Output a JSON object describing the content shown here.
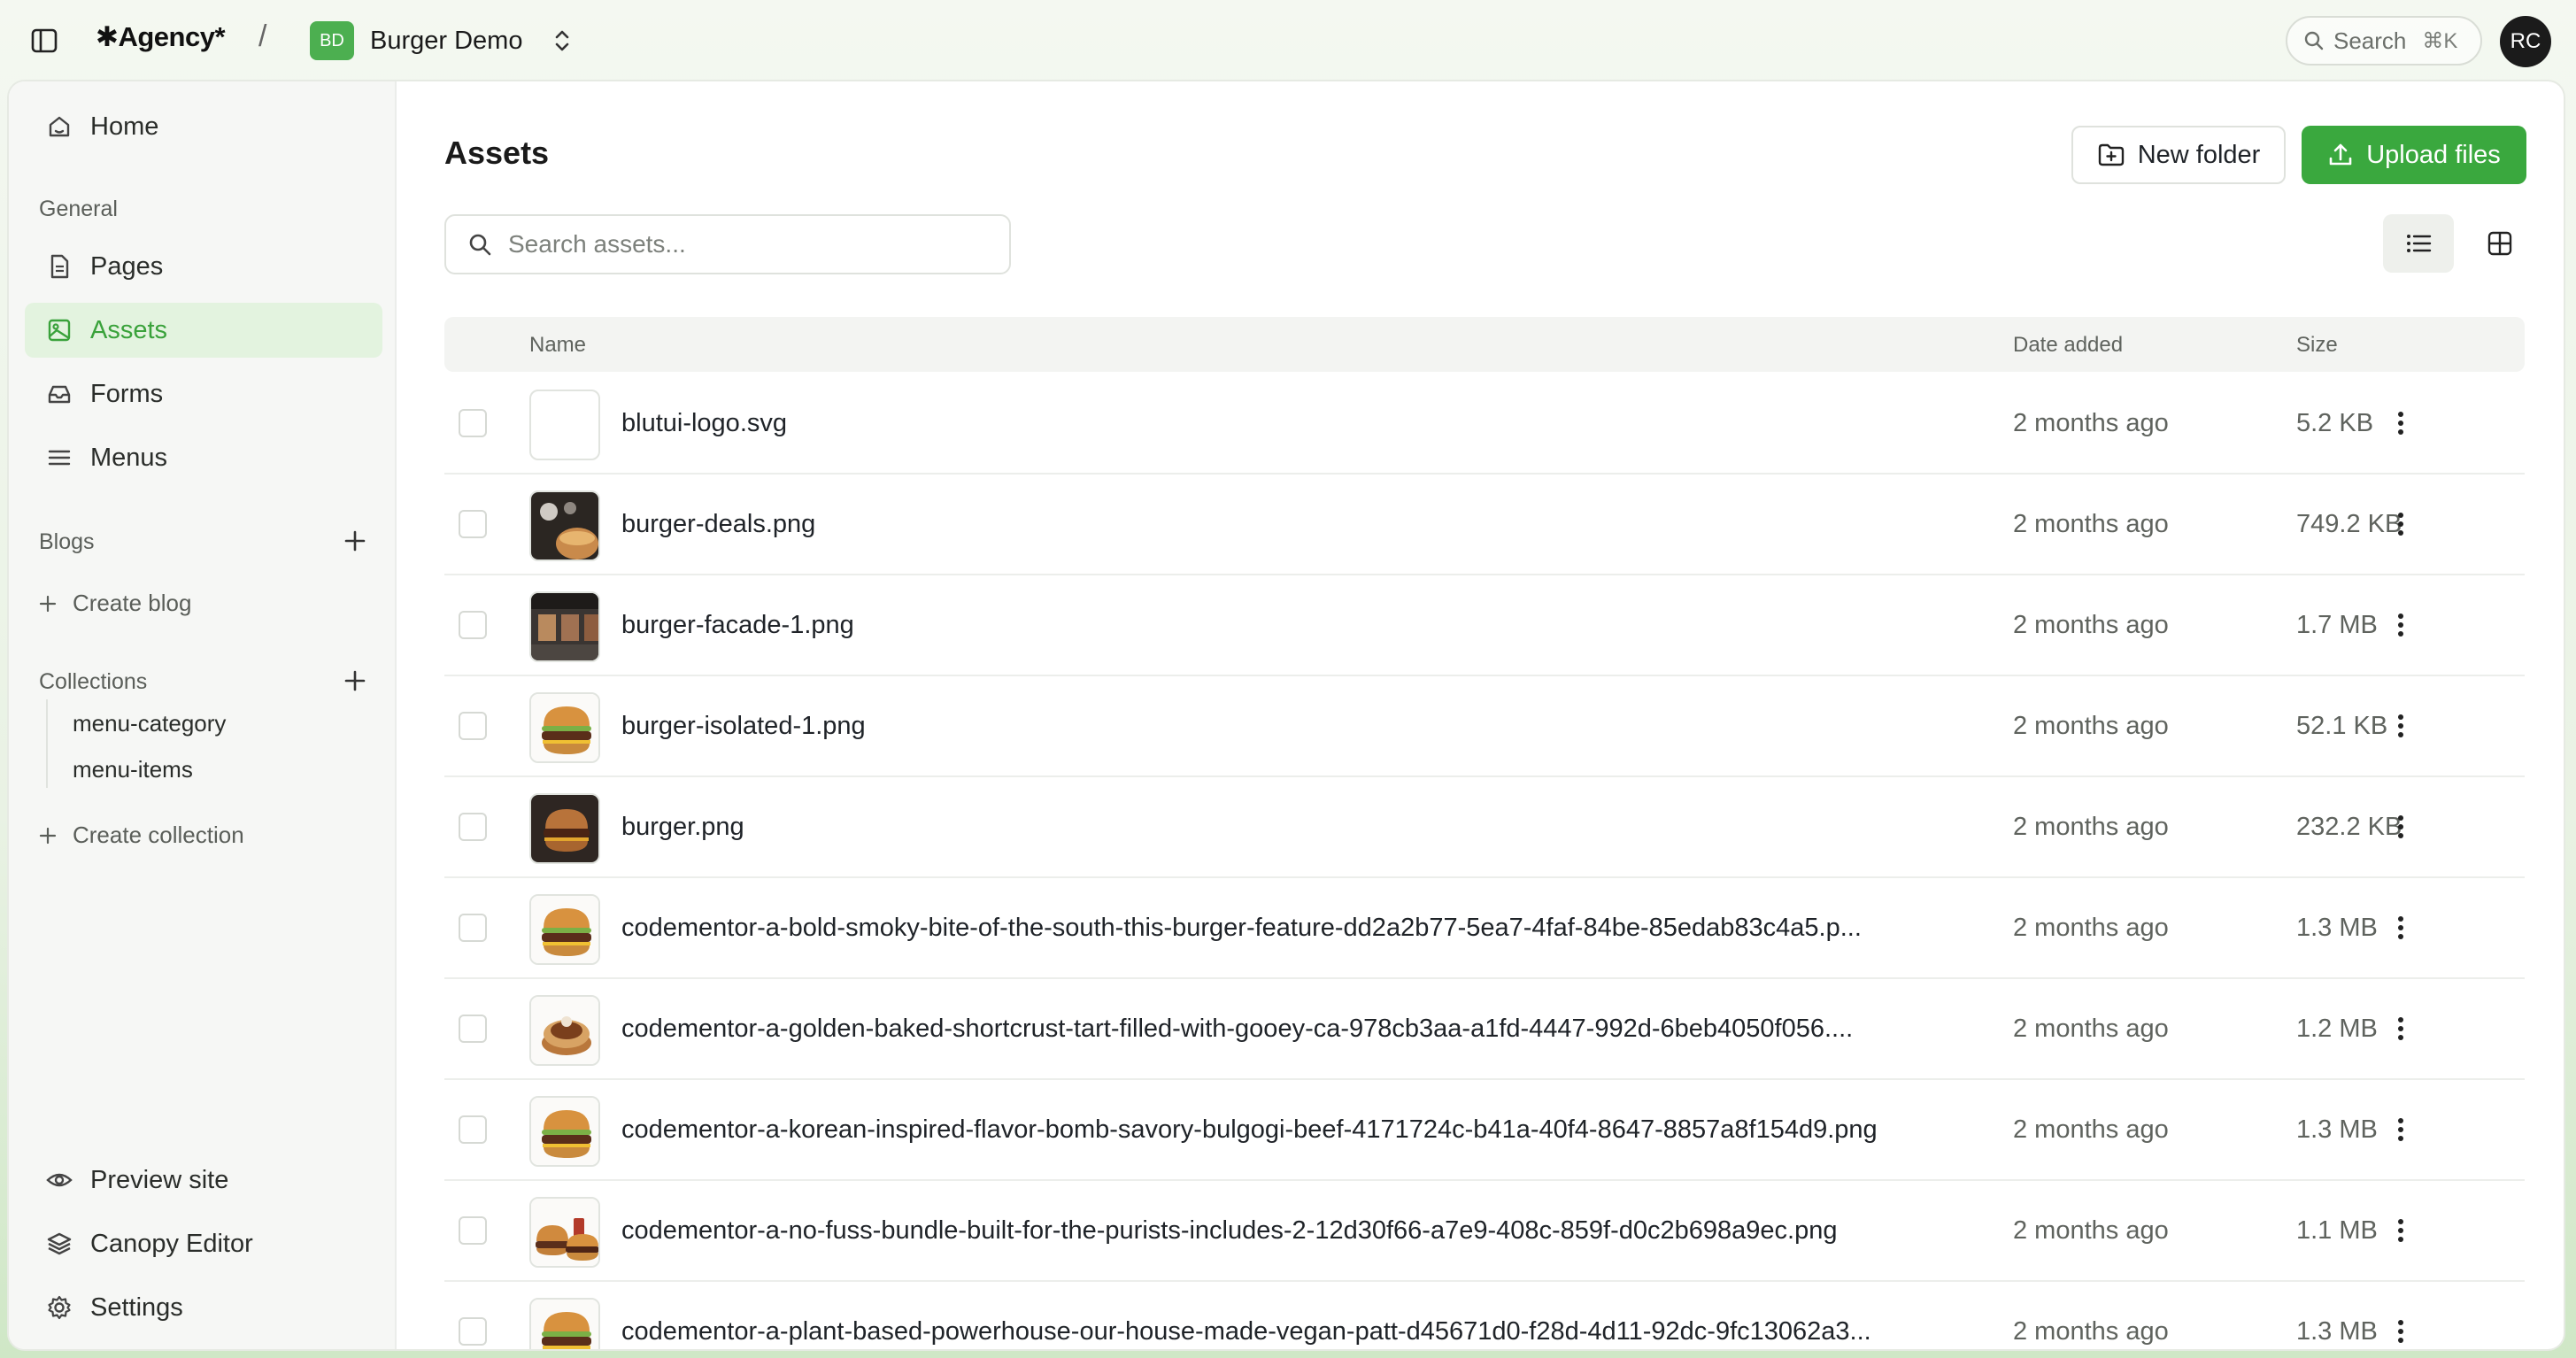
{
  "topbar": {
    "brand": "✱Agency*",
    "separator": "/",
    "project_initials": "BD",
    "project_name": "Burger Demo",
    "search_label": "Search",
    "search_shortcut": "⌘K",
    "user_initials": "RC"
  },
  "sidebar": {
    "home": "Home",
    "general_label": "General",
    "general_items": [
      "Pages",
      "Assets",
      "Forms",
      "Menus"
    ],
    "active_item": "Assets",
    "blogs_label": "Blogs",
    "create_blog": "Create blog",
    "collections_label": "Collections",
    "collections": [
      "menu-category",
      "menu-items"
    ],
    "create_collection": "Create collection",
    "footer_items": [
      "Preview site",
      "Canopy Editor",
      "Settings"
    ]
  },
  "main": {
    "title": "Assets",
    "new_folder": "New folder",
    "upload_files": "Upload files",
    "search_placeholder": "Search assets...",
    "columns": {
      "name": "Name",
      "date": "Date added",
      "size": "Size"
    },
    "rows": [
      {
        "name": "blutui-logo.svg",
        "date": "2 months ago",
        "size": "5.2 KB",
        "thumb": "blank"
      },
      {
        "name": "burger-deals.png",
        "date": "2 months ago",
        "size": "749.2 KB",
        "thumb": "dark-photo"
      },
      {
        "name": "burger-facade-1.png",
        "date": "2 months ago",
        "size": "1.7 MB",
        "thumb": "facade-photo"
      },
      {
        "name": "burger-isolated-1.png",
        "date": "2 months ago",
        "size": "52.1 KB",
        "thumb": "burger"
      },
      {
        "name": "burger.png",
        "date": "2 months ago",
        "size": "232.2 KB",
        "thumb": "dark-burger"
      },
      {
        "name": "codementor-a-bold-smoky-bite-of-the-south-this-burger-feature-dd2a2b77-5ea7-4faf-84be-85edab83c4a5.p...",
        "date": "2 months ago",
        "size": "1.3 MB",
        "thumb": "burger"
      },
      {
        "name": "codementor-a-golden-baked-shortcrust-tart-filled-with-gooey-ca-978cb3aa-a1fd-4447-992d-6beb4050f056....",
        "date": "2 months ago",
        "size": "1.2 MB",
        "thumb": "tart"
      },
      {
        "name": "codementor-a-korean-inspired-flavor-bomb-savory-bulgogi-beef-4171724c-b41a-40f4-8647-8857a8f154d9.png",
        "date": "2 months ago",
        "size": "1.3 MB",
        "thumb": "burger"
      },
      {
        "name": "codementor-a-no-fuss-bundle-built-for-the-purists-includes-2-12d30f66-a7e9-408c-859f-d0c2b698a9ec.png",
        "date": "2 months ago",
        "size": "1.1 MB",
        "thumb": "bundle"
      },
      {
        "name": "codementor-a-plant-based-powerhouse-our-house-made-vegan-patt-d45671d0-f28d-4d11-92dc-9fc13062a3...",
        "date": "2 months ago",
        "size": "1.3 MB",
        "thumb": "burger"
      }
    ]
  },
  "colors": {
    "accent": "#3aa83e",
    "active_bg": "#e3f3df"
  }
}
